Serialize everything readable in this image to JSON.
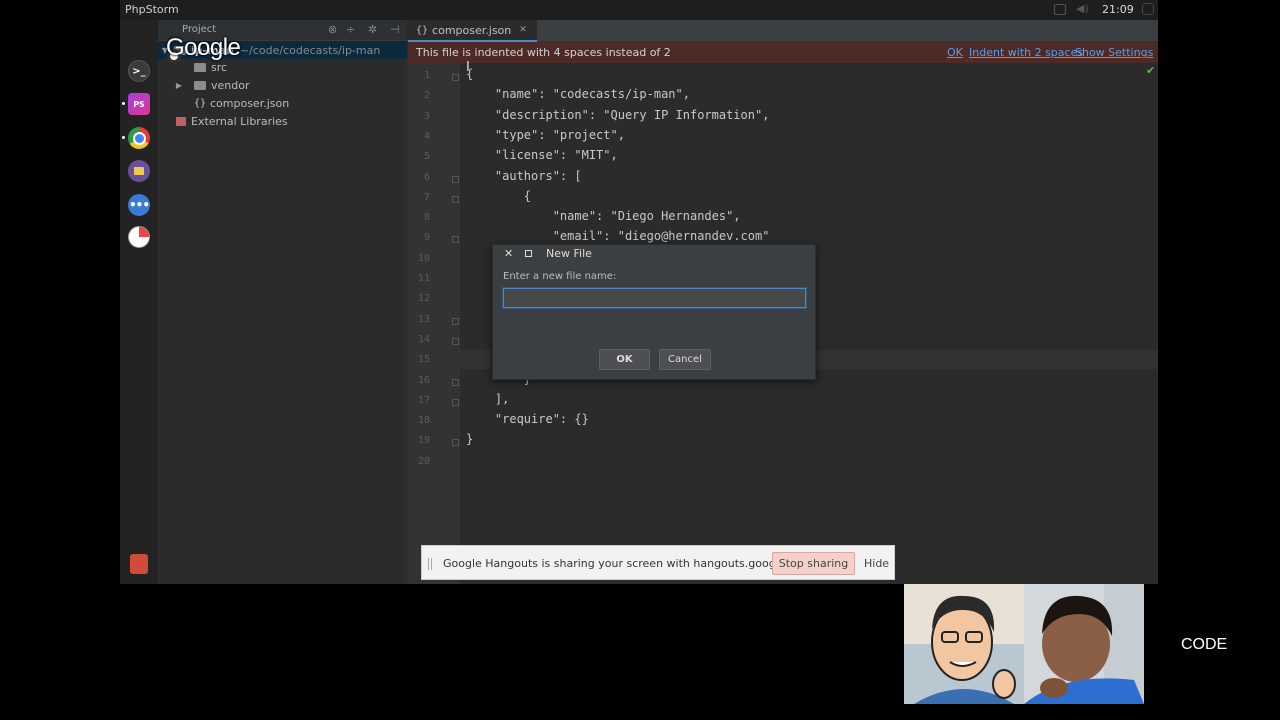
{
  "topbar": {
    "app_title": "PhpStorm",
    "clock": "21:09"
  },
  "overlay": {
    "google_logo": "Google"
  },
  "project": {
    "toolbar_label": "Project",
    "root": {
      "name": "ip-man",
      "path": "~/code/codecasts/ip-man"
    },
    "items": [
      {
        "label": "src"
      },
      {
        "label": "vendor"
      },
      {
        "label": "composer.json"
      },
      {
        "label": "External Libraries"
      }
    ]
  },
  "editor": {
    "tab": {
      "label": "composer.json"
    },
    "notice": {
      "message": "This file is indented with 4 spaces instead of 2",
      "ok": "OK",
      "indent": "Indent with 2 spaces",
      "settings": "Show Settings"
    },
    "line_numbers": [
      "1",
      "2",
      "3",
      "4",
      "5",
      "6",
      "7",
      "8",
      "9",
      "10",
      "11",
      "12",
      "13",
      "14",
      "15",
      "16",
      "17",
      "18",
      "19",
      "20"
    ],
    "lines": [
      "{",
      "    \"name\": \"codecasts/ip-man\",",
      "    \"description\": \"Query IP Information\",",
      "    \"type\": \"project\",",
      "    \"license\": \"MIT\",",
      "    \"authors\": [",
      "        {",
      "            \"name\": \"Diego Hernandes\",",
      "            \"email\": \"diego@hernandev.com\"",
      "",
      "",
      "",
      "",
      "",
      "",
      "        }",
      "    ],",
      "    \"require\": {}",
      "}",
      ""
    ]
  },
  "dialog": {
    "title": "New File",
    "prompt": "Enter a new file name:",
    "input_value": "",
    "ok": "OK",
    "cancel": "Cancel"
  },
  "hangouts": {
    "message": "Google Hangouts is sharing your screen with hangouts.google.com.",
    "stop": "Stop sharing",
    "hide": "Hide"
  },
  "stream_label": "CODE"
}
